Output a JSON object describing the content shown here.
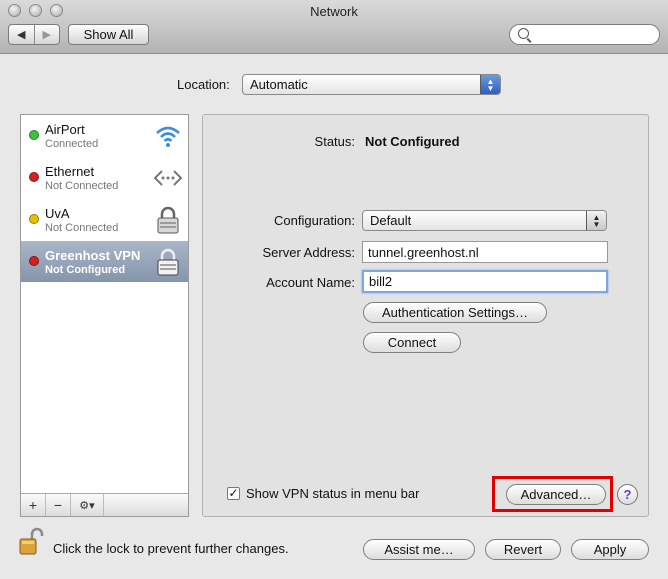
{
  "window": {
    "title": "Network"
  },
  "toolbar": {
    "back_label": "◀",
    "forward_label": "▶",
    "show_all_label": "Show All",
    "search_placeholder": ""
  },
  "location": {
    "label": "Location:",
    "value": "Automatic"
  },
  "services": [
    {
      "name": "AirPort",
      "status": "Connected",
      "dot_color": "#3cc23c",
      "icon": "wifi-icon"
    },
    {
      "name": "Ethernet",
      "status": "Not Connected",
      "dot_color": "#d42020",
      "icon": "ethernet-icon"
    },
    {
      "name": "UvA",
      "status": "Not Connected",
      "dot_color": "#e8c000",
      "icon": "vpn-lock-icon"
    },
    {
      "name": "Greenhost VPN",
      "status": "Not Configured",
      "dot_color": "#d42020",
      "icon": "vpn-lock-icon",
      "selected": true
    }
  ],
  "sidebar_toolbar": {
    "add": "+",
    "remove": "−",
    "gear": "⚙▾"
  },
  "detail": {
    "status_label": "Status:",
    "status_value": "Not Configured",
    "configuration_label": "Configuration:",
    "configuration_value": "Default",
    "server_label": "Server Address:",
    "server_value": "tunnel.greenhost.nl",
    "account_label": "Account Name:",
    "account_value": "bill2",
    "auth_button": "Authentication Settings…",
    "connect_button": "Connect",
    "show_vpn_label": "Show VPN status in menu bar",
    "show_vpn_checked": "✓",
    "advanced_button": "Advanced…",
    "help_label": "?"
  },
  "footer": {
    "lock_text": "Click the lock to prevent further changes.",
    "assist_button": "Assist me…",
    "revert_button": "Revert",
    "apply_button": "Apply"
  },
  "colors": {
    "selection": "#8d9cb1",
    "highlight_box": "#e00000",
    "accent": "#3b6fd1"
  }
}
